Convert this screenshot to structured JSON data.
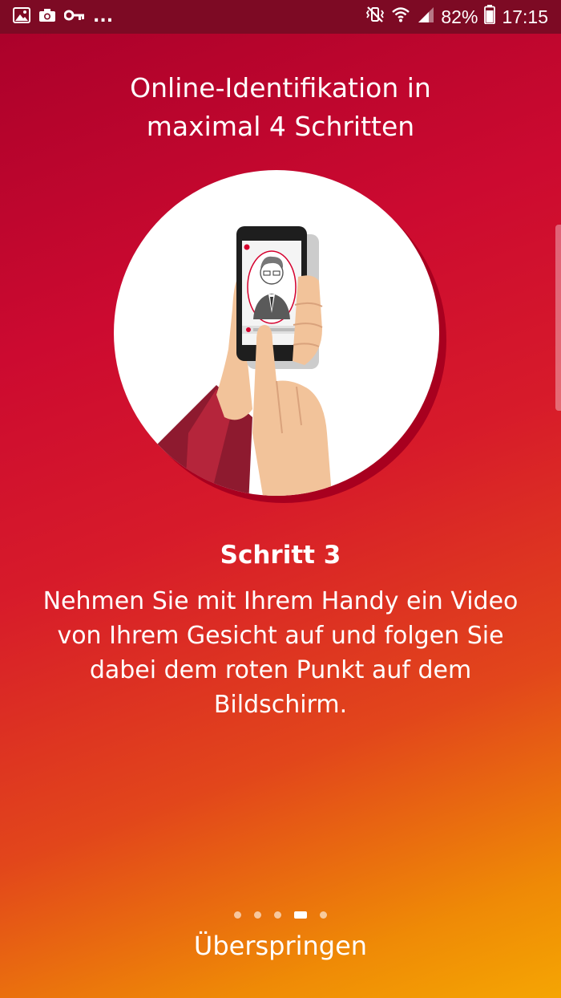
{
  "status_bar": {
    "left_icons": [
      "image-icon",
      "camera-icon",
      "key-icon",
      "more-dots-icon"
    ],
    "more_text": "...",
    "right_icons": [
      "mute-vibrate-icon",
      "wifi-icon",
      "signal-icon",
      "battery-icon"
    ],
    "battery_percent": "82%",
    "time": "17:15"
  },
  "header": {
    "title_line1": "Online-Identifikation in",
    "title_line2": "maximal 4 Schritten"
  },
  "step": {
    "title": "Schritt 3",
    "description": "Nehmen Sie mit Ihrem Handy ein Video von Ihrem Gesicht auf und folgen Sie dabei dem roten Punkt auf dem Bildschirm."
  },
  "pager": {
    "total": 5,
    "active_index": 3
  },
  "skip_label": "Überspringen",
  "colors": {
    "status_bar": "#7d0a24",
    "gradient_top": "#a8002a",
    "gradient_bottom": "#f5a503",
    "accent_red": "#d5002d"
  }
}
